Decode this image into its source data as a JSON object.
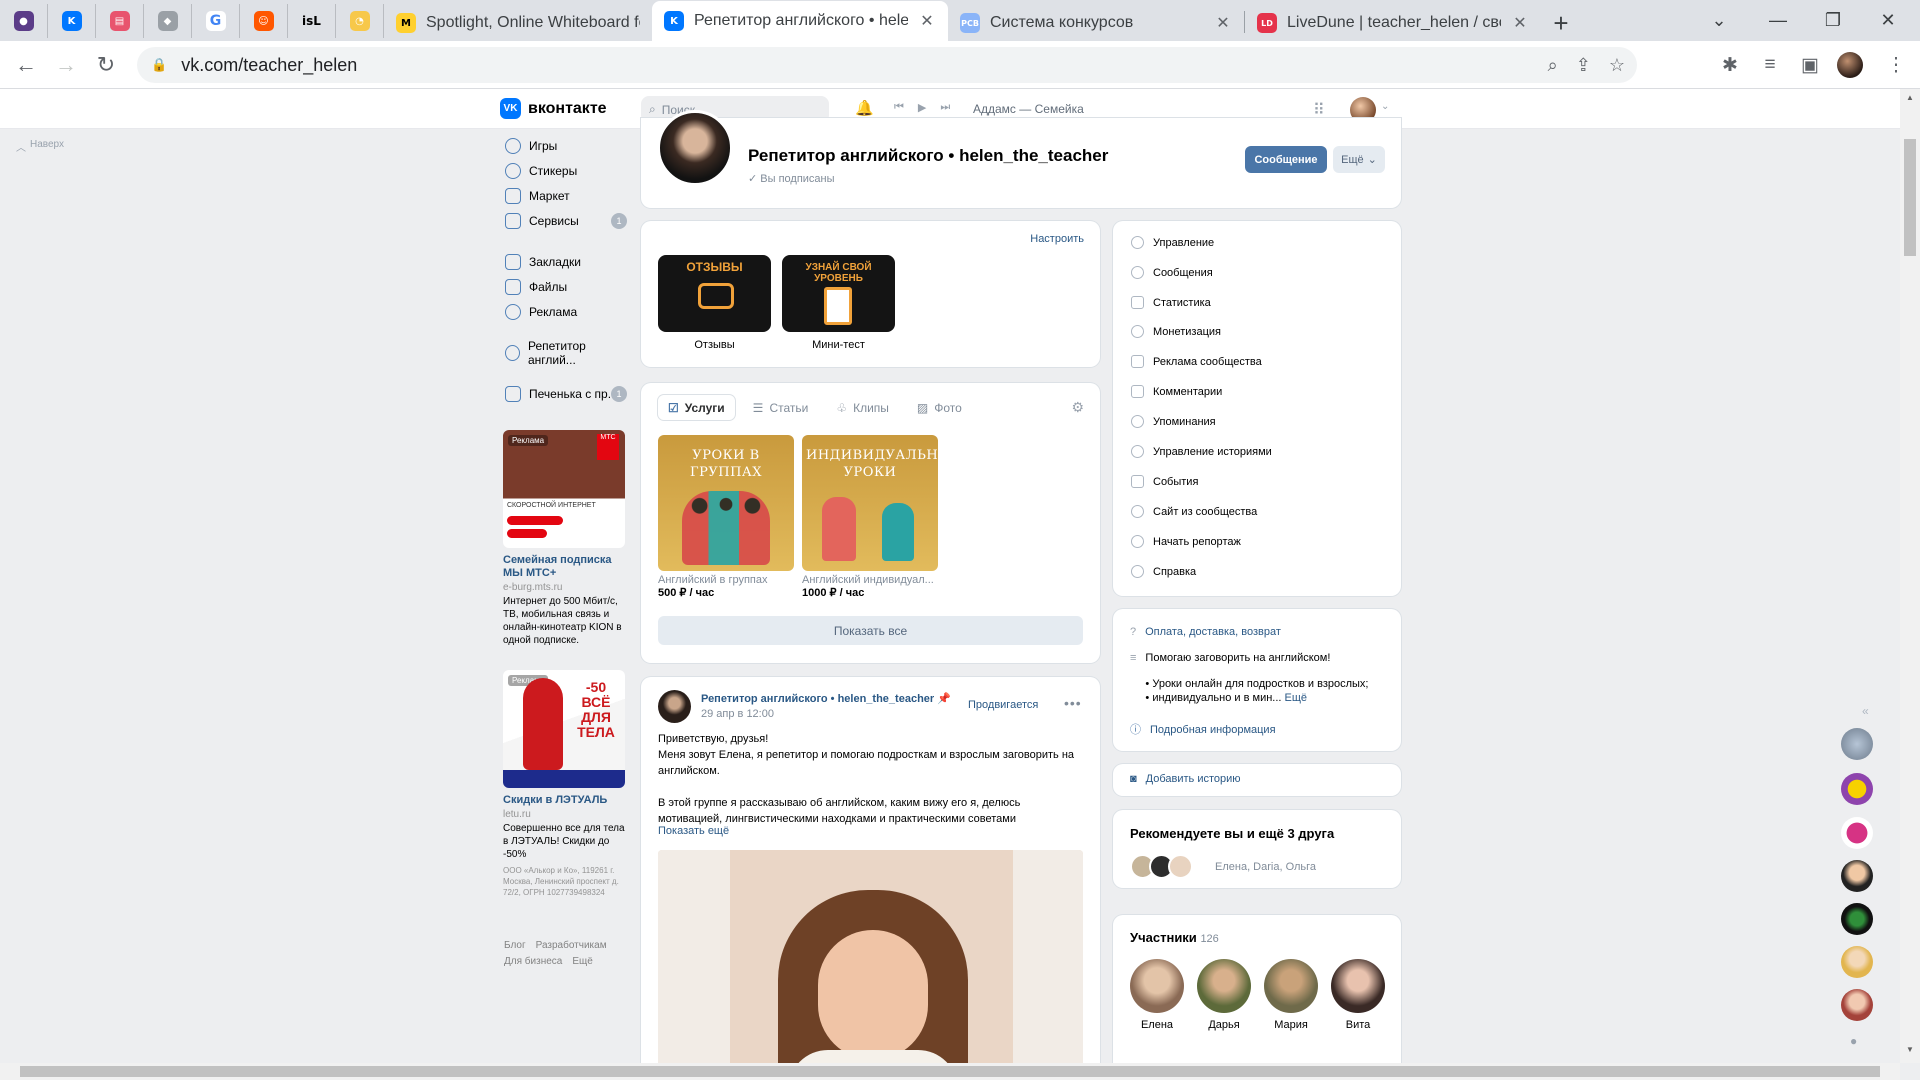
{
  "browser": {
    "tabs": [
      {
        "title": "Spotlight, Online Whiteboard for"
      },
      {
        "title": "Репетитор английского • helen_",
        "active": true
      },
      {
        "title": "Система конкурсов"
      },
      {
        "title": "LiveDune | teacher_helen / свод"
      }
    ],
    "pinned_tab_labels": [
      "isL"
    ],
    "url": "vk.com/teacher_helen"
  },
  "vk_header": {
    "logo": "вконтакте",
    "search_placeholder": "Поиск",
    "now_playing": "Аддамс — Семейка"
  },
  "left_nav": {
    "up_link": "Наверх",
    "items": [
      {
        "label": "Игры",
        "icon": "games-icon"
      },
      {
        "label": "Стикеры",
        "icon": "stickers-icon"
      },
      {
        "label": "Маркет",
        "icon": "market-icon"
      },
      {
        "label": "Сервисы",
        "icon": "services-icon",
        "badge": "1"
      },
      {
        "label": "Закладки",
        "icon": "bookmarks-icon"
      },
      {
        "label": "Файлы",
        "icon": "files-icon"
      },
      {
        "label": "Реклама",
        "icon": "ads-icon"
      },
      {
        "label": "Репетитор англий...",
        "icon": "community-icon"
      },
      {
        "label": "Печенька с пр...",
        "icon": "app-icon",
        "badge": "1"
      }
    ],
    "ads": [
      {
        "tag": "Реклама",
        "title": "Семейная подписка МЫ МТС+",
        "site": "e-burg.mts.ru",
        "text": "Интернет до 500 Мбит/с, ТВ, мобильная связь и онлайн-кинотеатр KION в одной подписке.",
        "legal": "",
        "image_text": "СКОРОСТНОЙ ИНТЕРНЕТ"
      },
      {
        "tag": "Реклама",
        "title": "Скидки в ЛЭТУАЛЬ",
        "site": "letu.ru",
        "text": "Совершенно все для тела в ЛЭТУАЛЬ! Скидки до -50%",
        "legal": "ООО «Алькор и Ко», 119261 г. Москва, Ленинский проспект д. 72/2, ОГРН 1027739498324",
        "image_text": "-50 ВСЁ ДЛЯ ТЕЛА"
      }
    ],
    "footer": [
      "Блог",
      "Разработчикам",
      "Для бизнеса",
      "Ещё"
    ]
  },
  "community": {
    "name": "Репетитор английского • helen_the_teacher",
    "subscribed_label": "Вы подписаны",
    "message_button": "Сообщение",
    "more_button": "Ещё"
  },
  "widgets": {
    "setup_link": "Настроить",
    "tiles": [
      {
        "caption": "Отзывы",
        "image_text": "ОТЗЫВЫ"
      },
      {
        "caption": "Мини-тест",
        "image_text": "УЗНАЙ СВОЙ УРОВЕНЬ"
      }
    ]
  },
  "products": {
    "tabs": [
      "Услуги",
      "Статьи",
      "Клипы",
      "Фото"
    ],
    "active_tab": "Услуги",
    "items": [
      {
        "image_text": "УРОКИ В ГРУППАХ",
        "name": "Английский в группах",
        "price": "500 ₽ / час"
      },
      {
        "image_text": "ИНДИВИДУАЛЬНЫЕ УРОКИ",
        "name": "Английский индивидуал...",
        "price": "1000 ₽ / час"
      }
    ],
    "show_all": "Показать все"
  },
  "post": {
    "author": "Репетитор английского • helen_the_teacher",
    "date": "29 апр в 12:00",
    "promo": "Продвигается",
    "text_lines": [
      "Приветствую, друзья!",
      "Меня зовут Елена, я репетитор и помогаю подросткам и взрослым заговорить на английском.",
      "",
      "В этой группе я рассказываю об английском, каким вижу его я, делюсь мотивацией, лингвистическими находками и практическими советами"
    ],
    "show_more": "Показать ещё"
  },
  "right_menu": {
    "items": [
      {
        "label": "Управление",
        "icon": "gear-icon"
      },
      {
        "label": "Сообщения",
        "icon": "message-icon"
      },
      {
        "label": "Статистика",
        "icon": "stats-icon"
      },
      {
        "label": "Монетизация",
        "icon": "money-icon"
      },
      {
        "label": "Реклама сообщества",
        "icon": "megaphone-icon"
      },
      {
        "label": "Комментарии",
        "icon": "comment-icon"
      },
      {
        "label": "Упоминания",
        "icon": "mention-icon"
      },
      {
        "label": "Управление историями",
        "icon": "stories-icon"
      },
      {
        "label": "События",
        "icon": "event-icon"
      },
      {
        "label": "Сайт из сообщества",
        "icon": "site-icon"
      },
      {
        "label": "Начать репортаж",
        "icon": "broadcast-icon"
      },
      {
        "label": "Справка",
        "icon": "help-icon"
      }
    ]
  },
  "info": {
    "delivery_link": "Оплата, доставка, возврат",
    "description_1": "Помогаю заговорить на английском!",
    "description_2": "• Уроки онлайн для подростков и взрослых;",
    "description_3": "• индивидуально и в мин...",
    "more_link": "Ещё",
    "details_link": "Подробная информация"
  },
  "story": {
    "label": "Добавить историю"
  },
  "recommend": {
    "title": "Рекомендуете вы и ещё 3 друга",
    "names": "Елена, Daria, Ольга"
  },
  "members": {
    "title": "Участники",
    "count": "126",
    "people": [
      "Елена",
      "Дарья",
      "Мария",
      "Вита"
    ]
  },
  "colors": {
    "vk_blue": "#0077ff",
    "link": "#2a5885",
    "button_primary": "#4a76a8",
    "bg": "#edeef0"
  }
}
